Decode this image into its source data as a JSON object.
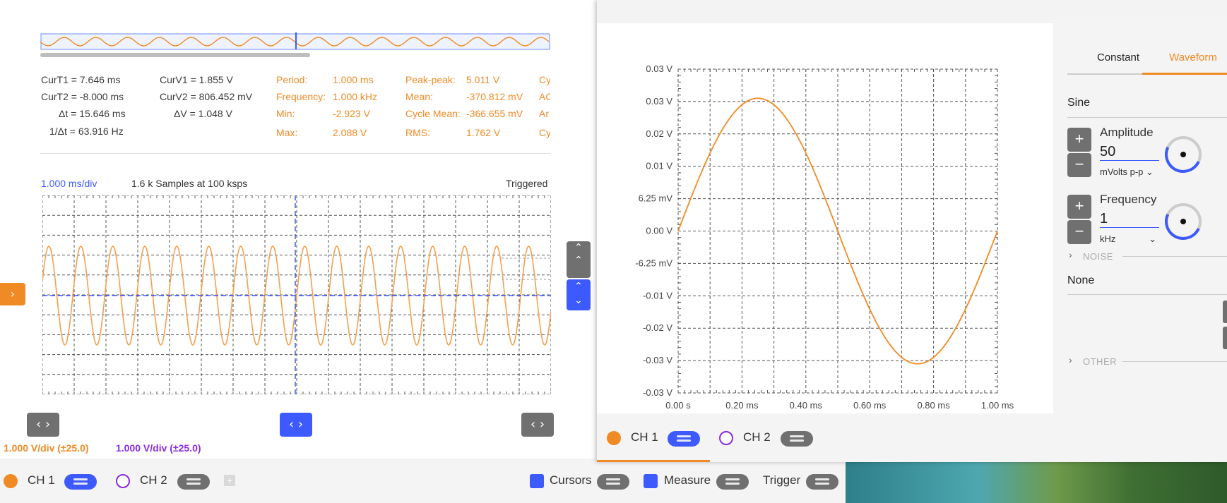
{
  "scope": {
    "measurements": {
      "curT1": "CurT1 = 7.646 ms",
      "curT2": "CurT2 = -8.000 ms",
      "dt": "Δt = 15.646 ms",
      "inv_dt": "1/Δt = 63.916 Hz",
      "curV1": "CurV1 = 1.855 V",
      "curV2": "CurV2 = 806.452 mV",
      "dV": "ΔV =  1.048 V",
      "period_label": "Period:",
      "period_value": "1.000 ms",
      "freq_label": "Frequency:",
      "freq_value": "1.000 kHz",
      "min_label": "Min:",
      "min_value": "-2.923 V",
      "max_label": "Max:",
      "max_value": "2.088 V",
      "pp_label": "Peak-peak:",
      "pp_value": "5.011 V",
      "mean_label": "Mean:",
      "mean_value": "-370.812 mV",
      "cmean_label": "Cycle Mean:",
      "cmean_value": "-366.655 mV",
      "rms_label": "RMS:",
      "rms_value": "1.762 V",
      "cut1": "Cy",
      "cut2": "AC",
      "cut3": "Ar",
      "cut4": "Cy"
    },
    "timebase": "1.000 ms/div",
    "samples": "1.6 k Samples at 100 ksps",
    "status": "Triggered",
    "ch1_scale": "1.000 V/div (±25.0)",
    "ch2_scale": "1.000 V/div (±25.0)",
    "bottom": {
      "ch1": "CH 1",
      "ch2": "CH 2",
      "cursors": "Cursors",
      "measure": "Measure",
      "trigger": "Trigger"
    },
    "colors": {
      "ch1": "#f08a24",
      "ch2": "#8a2be2",
      "accent": "#3d5afe"
    }
  },
  "generator": {
    "tabs": [
      "Constant",
      "Waveform"
    ],
    "waveform": "Sine",
    "amplitude_label": "Amplitude",
    "amplitude_value": "50",
    "amplitude_unit": "mVolts p-p",
    "frequency_label": "Frequency",
    "frequency_value": "1",
    "frequency_unit": "kHz",
    "noise_label": "NOISE",
    "noise_value": "None",
    "other_label": "OTHER",
    "ch1": "CH 1",
    "ch2": "CH 2"
  },
  "chart_data": {
    "type": "line",
    "title": "",
    "xlabel": "",
    "ylabel": "",
    "x_ticks": [
      "0.00 s",
      "0.20 ms",
      "0.40 ms",
      "0.60 ms",
      "0.80 ms",
      "1.00 ms"
    ],
    "y_ticks": [
      "0.03 V",
      "0.03 V",
      "0.02 V",
      "0.01 V",
      "6.25 mV",
      "0.00 V",
      "-6.25 mV",
      "-0.01 V",
      "-0.02 V",
      "-0.03 V",
      "-0.03 V"
    ],
    "xlim": [
      0,
      1.0
    ],
    "ylim": [
      -0.025,
      0.025
    ],
    "series": [
      {
        "color": "#f08a24",
        "amplitude": 0.025,
        "frequency_khz": 1,
        "cycles": 1
      }
    ]
  }
}
